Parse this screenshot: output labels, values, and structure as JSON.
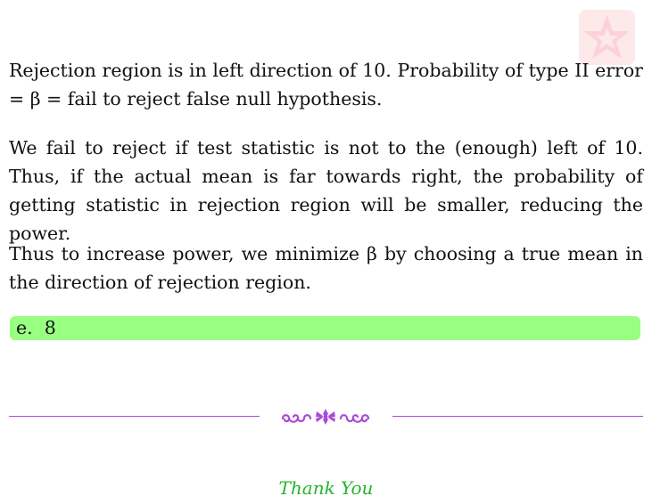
{
  "paragraphs": [
    "Rejection region is in left direction of 10.  Probability of type II error = β = fail to reject false null hypothesis.",
    "We fail to reject if test statistic is not to the (enough) left of 10.  Thus, if the actual mean is far towards right, the probability of getting statistic in rejection region will be smaller, reducing the power.",
    "Thus to increase power, we minimize β by choosing a true mean in the direction of rejection region."
  ],
  "answer": {
    "label": "e.",
    "value": "8"
  },
  "footer": {
    "closing_text": "Thank You"
  },
  "colors": {
    "answer_highlight": "#99ff80",
    "divider": "#a94bd8",
    "closing_text": "#22b52c",
    "logo_bg": "#fde9ea"
  },
  "icons": {
    "logo": "star-logo-icon",
    "ornament": "floral-ornament-icon"
  }
}
